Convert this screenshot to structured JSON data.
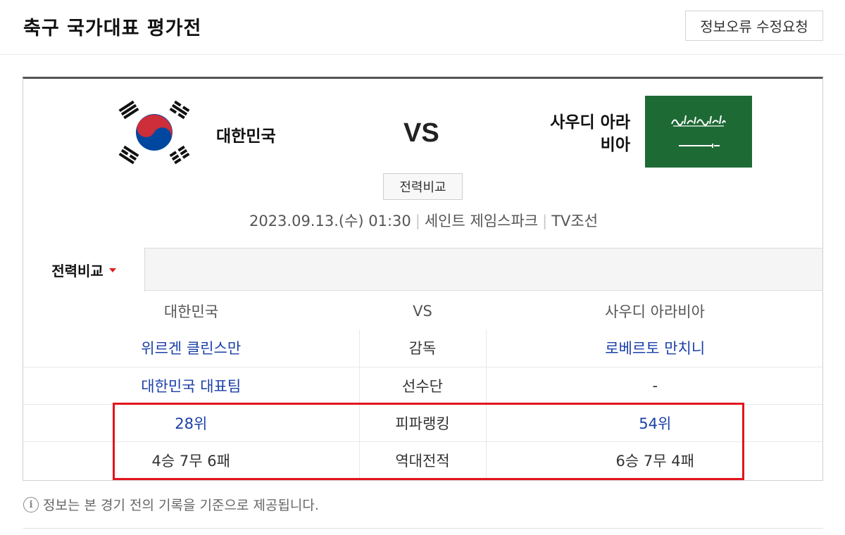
{
  "header": {
    "title": "축구 국가대표 평가전",
    "report_button": "정보오류 수정요청"
  },
  "match": {
    "home_team": "대한민국",
    "away_team_line1": "사우디 아라",
    "away_team_line2": "비아",
    "vs": "VS",
    "compare_button": "전력비교",
    "date": "2023.09.13.(수) 01:30",
    "venue": "세인트 제임스파크",
    "broadcaster": "TV조선",
    "home_flag_icon": "south-korea-flag-icon",
    "away_flag_icon": "saudi-arabia-flag-icon"
  },
  "tabs": {
    "active": "전력비교"
  },
  "comparison": {
    "header": {
      "home": "대한민국",
      "vs": "VS",
      "away": "사우디 아라비아"
    },
    "rows": [
      {
        "label": "감독",
        "home": "위르겐 클린스만",
        "away": "로베르토 만치니"
      },
      {
        "label": "선수단",
        "home": "대한민국 대표팀",
        "away": "-"
      },
      {
        "label": "피파랭킹",
        "home": "28위",
        "away": "54위"
      },
      {
        "label": "역대전적",
        "home": "4승 7무 6패",
        "away": "6승 7무 4패"
      }
    ]
  },
  "footer": {
    "info_icon": "info-icon",
    "note": "정보는 본 경기 전의 기록을 기준으로 제공됩니다."
  },
  "colors": {
    "link": "#1a3fa8",
    "highlight": "#e3141c",
    "saudi_green": "#1e6a35",
    "korea_red": "#cd2e3a",
    "korea_blue": "#0047a0"
  }
}
